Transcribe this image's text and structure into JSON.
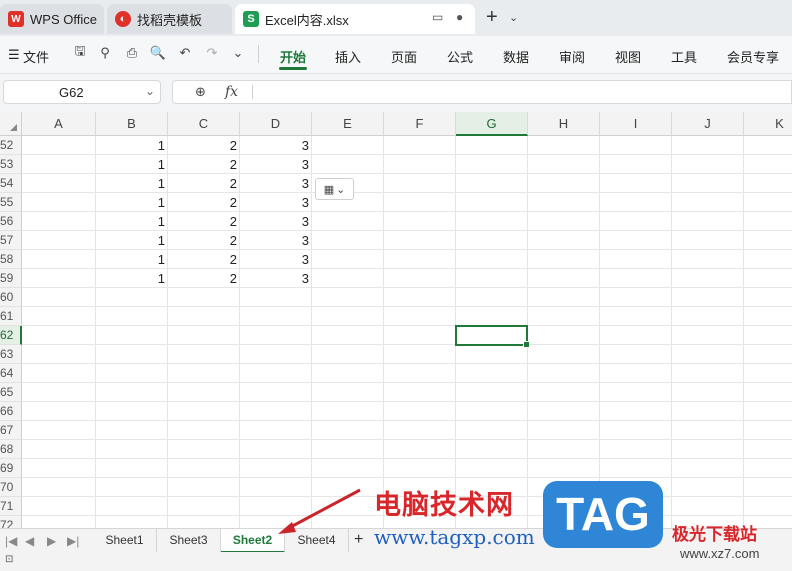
{
  "titlebar": {
    "tabs": [
      {
        "label": "WPS Office",
        "icon": "wps-logo-icon"
      },
      {
        "label": "找稻壳模板",
        "icon": "docer-icon"
      },
      {
        "label": "Excel内容.xlsx",
        "icon": "spreadsheet-icon",
        "icon_letter": "S"
      }
    ]
  },
  "menubar": {
    "file_label": "文件",
    "tabs": [
      "开始",
      "插入",
      "页面",
      "公式",
      "数据",
      "审阅",
      "视图",
      "工具",
      "会员专享"
    ],
    "active_tab": "开始"
  },
  "formula": {
    "name_box": "G62",
    "fx_label": "fx",
    "content": ""
  },
  "grid": {
    "columns": [
      "A",
      "B",
      "C",
      "D",
      "E",
      "F",
      "G",
      "H",
      "I",
      "J",
      "K"
    ],
    "selected_column": "G",
    "rows": [
      "52",
      "53",
      "54",
      "55",
      "56",
      "57",
      "58",
      "59",
      "60",
      "61",
      "62",
      "63",
      "64",
      "65",
      "66",
      "67",
      "68",
      "69",
      "70",
      "71",
      "72"
    ],
    "selected_row": "62",
    "selected_cell": "G62",
    "data": [
      [
        "1",
        "2",
        "3"
      ],
      [
        "1",
        "2",
        "3"
      ],
      [
        "1",
        "2",
        "3"
      ],
      [
        "1",
        "2",
        "3"
      ],
      [
        "1",
        "2",
        "3"
      ],
      [
        "1",
        "2",
        "3"
      ],
      [
        "1",
        "2",
        "3"
      ],
      [
        "1",
        "2",
        "3"
      ]
    ]
  },
  "sheets": {
    "tabs": [
      "Sheet1",
      "Sheet3",
      "Sheet2",
      "Sheet4"
    ],
    "active": "Sheet2"
  },
  "watermark": {
    "title": "电脑技术网",
    "url": "www.tagxp.com",
    "logo_text": "TAG",
    "site_name": "极光下载站",
    "site_url": "www.xz7.com"
  },
  "colors": {
    "accent": "#1f7a3a",
    "watermark_red": "#d8262b",
    "watermark_blue": "#2f86d6"
  }
}
